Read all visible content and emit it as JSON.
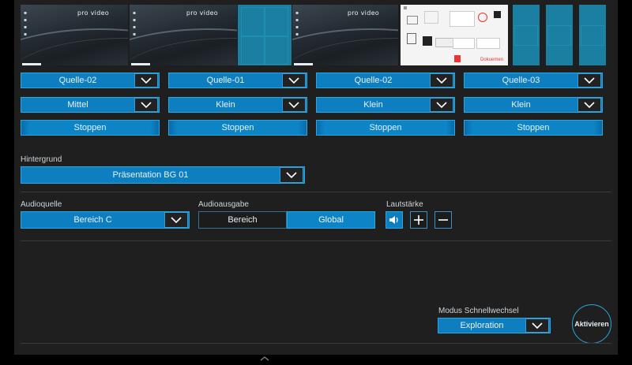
{
  "previews": [
    {
      "type": "video-dark",
      "brand": "pro video"
    },
    {
      "type": "video-dark",
      "brand": "pro video"
    },
    {
      "type": "video-dark-split",
      "brand": "pro video"
    },
    {
      "type": "video-dark",
      "brand": "pro video"
    },
    {
      "type": "document-white",
      "brand": "Dokuemen"
    },
    {
      "type": "teal-grid"
    }
  ],
  "sources": [
    {
      "source": "Quelle-02",
      "size": "Mittel",
      "stop": "Stoppen"
    },
    {
      "source": "Quelle-01",
      "size": "Klein",
      "stop": "Stoppen"
    },
    {
      "source": "Quelle-02",
      "size": "Klein",
      "stop": "Stoppen"
    },
    {
      "source": "Quelle-03",
      "size": "Klein",
      "stop": "Stoppen"
    }
  ],
  "background": {
    "label": "Hintergrund",
    "value": "Präsentation BG 01"
  },
  "audio": {
    "source_label": "Audioquelle",
    "source_value": "Bereich C",
    "output_label": "Audioausgabe",
    "output_options": [
      "Bereich",
      "Global"
    ],
    "output_selected": "Global",
    "volume_label": "Lautstärke"
  },
  "quick_switch": {
    "label": "Modus Schnellwechsel",
    "value": "Exploration"
  },
  "activate_label": "Aktivieren",
  "colors": {
    "accent": "#0d84c6",
    "accent_border": "#2aa6e0",
    "panel": "#1f1f1f",
    "background": "#000000"
  },
  "icons": {
    "dropdown": "chevron-down-icon",
    "speaker": "speaker-icon",
    "plus": "plus-icon",
    "minus": "minus-icon"
  }
}
